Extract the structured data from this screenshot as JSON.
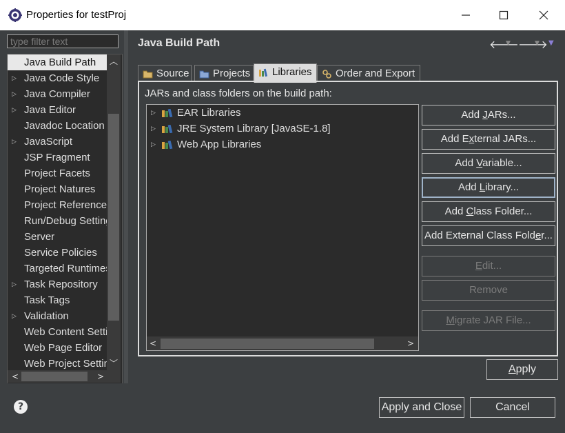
{
  "window": {
    "title": "Properties for testProj",
    "icons": {
      "app": "eclipse-gear-icon",
      "minimize": "minimize-icon",
      "maximize": "maximize-icon",
      "close": "close-icon"
    }
  },
  "left": {
    "filter_placeholder": "type filter text",
    "items": [
      {
        "label": "Java Build Path",
        "expandable": false,
        "selected": true
      },
      {
        "label": "Java Code Style",
        "expandable": true
      },
      {
        "label": "Java Compiler",
        "expandable": true
      },
      {
        "label": "Java Editor",
        "expandable": true
      },
      {
        "label": "Javadoc Location",
        "expandable": false
      },
      {
        "label": "JavaScript",
        "expandable": true
      },
      {
        "label": "JSP Fragment",
        "expandable": false
      },
      {
        "label": "Project Facets",
        "expandable": false
      },
      {
        "label": "Project Natures",
        "expandable": false
      },
      {
        "label": "Project References",
        "expandable": false
      },
      {
        "label": "Run/Debug Settings",
        "expandable": false
      },
      {
        "label": "Server",
        "expandable": false
      },
      {
        "label": "Service Policies",
        "expandable": false
      },
      {
        "label": "Targeted Runtimes",
        "expandable": false
      },
      {
        "label": "Task Repository",
        "expandable": true
      },
      {
        "label": "Task Tags",
        "expandable": false
      },
      {
        "label": "Validation",
        "expandable": true
      },
      {
        "label": "Web Content Settings",
        "expandable": false
      },
      {
        "label": "Web Page Editor",
        "expandable": false
      },
      {
        "label": "Web Project Settings",
        "expandable": false
      }
    ]
  },
  "right": {
    "title": "Java Build Path",
    "tabs": [
      {
        "label": "Source",
        "icon": "source-folder-icon"
      },
      {
        "label": "Projects",
        "icon": "projects-folder-icon"
      },
      {
        "label": "Libraries",
        "icon": "libraries-icon",
        "active": true
      },
      {
        "label": "Order and Export",
        "icon": "order-export-icon"
      }
    ],
    "jars_label": "JARs and class folders on the build path:",
    "libraries": [
      {
        "label": "EAR Libraries"
      },
      {
        "label": "JRE System Library [JavaSE-1.8]"
      },
      {
        "label": "Web App Libraries"
      }
    ],
    "buttons": {
      "add_jars": {
        "pre": "Add ",
        "u": "J",
        "post": "ARs..."
      },
      "add_external_jars": {
        "pre": "Add E",
        "u": "x",
        "post": "ternal JARs..."
      },
      "add_variable": {
        "pre": "Add ",
        "u": "V",
        "post": "ariable..."
      },
      "add_library": {
        "pre": "Add ",
        "u": "L",
        "post": "ibrary..."
      },
      "add_class_folder": {
        "pre": "Add ",
        "u": "C",
        "post": "lass Folder..."
      },
      "add_external_class_folder": {
        "pre": "Add External Class Fold",
        "u": "e",
        "post": "r..."
      },
      "edit": {
        "pre": "",
        "u": "E",
        "post": "dit..."
      },
      "remove": "Remove",
      "migrate": {
        "pre": "",
        "u": "M",
        "post": "igrate JAR File..."
      }
    },
    "apply": {
      "u": "A",
      "post": "pply"
    }
  },
  "bottom": {
    "help_icon": "help-icon",
    "apply_close": "Apply and Close",
    "cancel": "Cancel"
  }
}
